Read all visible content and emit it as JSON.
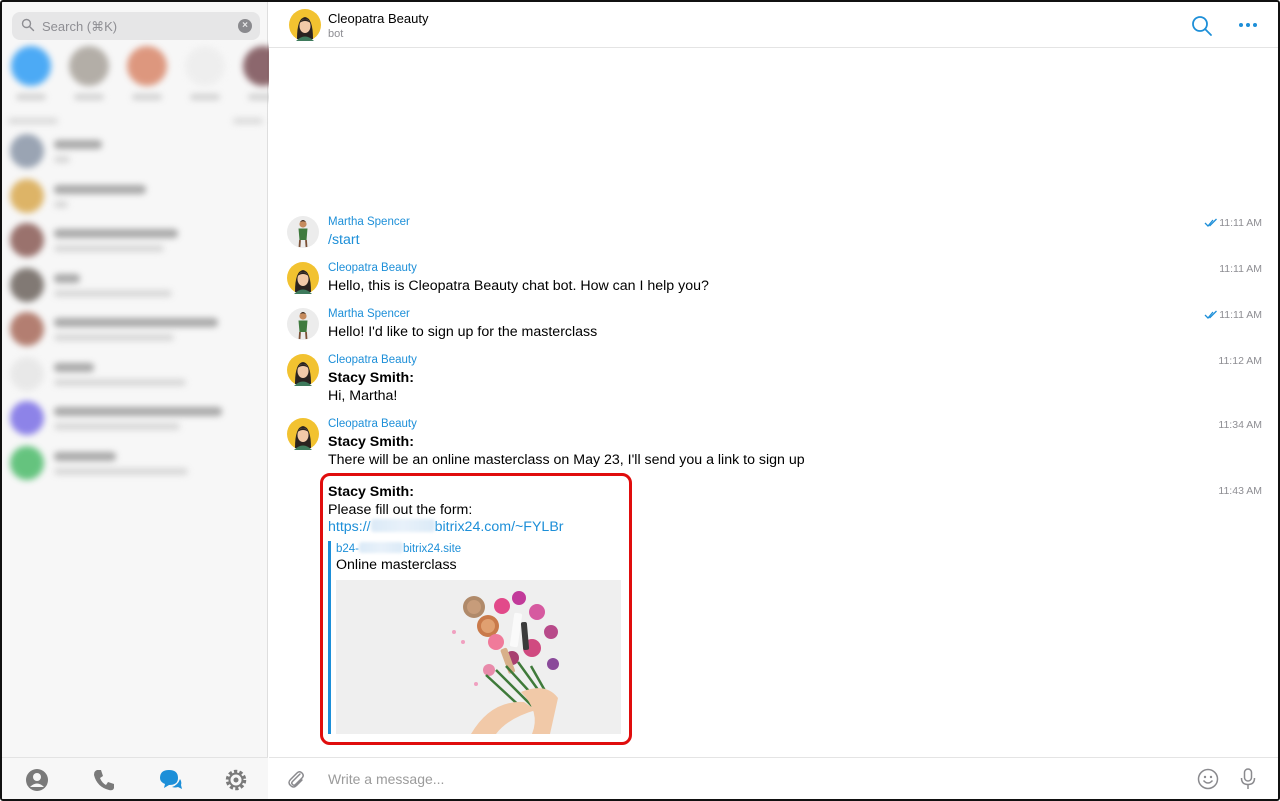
{
  "sidebar": {
    "search": {
      "placeholder": "Search (⌘K)"
    },
    "favorites": [
      "#2f9df5",
      "#a8a29a",
      "#d9876a",
      "#ededed",
      "#7a4f55"
    ],
    "chats": [
      {
        "avatar_color": "#8a96a8",
        "w1": 48,
        "w2": 16
      },
      {
        "avatar_color": "#d9a94f",
        "w1": 92,
        "w2": 14
      },
      {
        "avatar_color": "#8a5b55",
        "w1": 124,
        "w2": 110
      },
      {
        "avatar_color": "#6d645e",
        "w1": 26,
        "w2": 118
      },
      {
        "avatar_color": "#a86a5a",
        "w1": 164,
        "w2": 120
      },
      {
        "avatar_color": "#e6e6e6",
        "w1": 40,
        "w2": 132
      },
      {
        "avatar_color": "#7b6fe6",
        "w1": 168,
        "w2": 126
      },
      {
        "avatar_color": "#4cbb6a",
        "w1": 62,
        "w2": 134
      }
    ]
  },
  "header": {
    "title": "Cleopatra Beauty",
    "subtitle": "bot"
  },
  "messages": [
    {
      "author": "Martha Spencer",
      "time": "11:11 AM",
      "read": true,
      "avatar": "martha",
      "lines": [
        {
          "text": "/start",
          "style": "cmd"
        }
      ]
    },
    {
      "author": "Cleopatra Beauty",
      "time": "11:11 AM",
      "read": false,
      "avatar": "cleo",
      "lines": [
        {
          "text": "Hello, this is Cleopatra Beauty chat bot. How can I help you?",
          "style": ""
        }
      ]
    },
    {
      "author": "Martha Spencer",
      "time": "11:11 AM",
      "read": true,
      "avatar": "martha",
      "lines": [
        {
          "text": "Hello! I'd like to sign up for the masterclass",
          "style": ""
        }
      ]
    },
    {
      "author": "Cleopatra Beauty",
      "time": "11:12 AM",
      "read": false,
      "avatar": "cleo",
      "lines": [
        {
          "text": "Stacy Smith:",
          "style": "bold"
        },
        {
          "text": "Hi, Martha!",
          "style": ""
        }
      ]
    },
    {
      "author": "Cleopatra Beauty",
      "time": "11:34 AM",
      "read": false,
      "avatar": "cleo",
      "lines": [
        {
          "text": "Stacy Smith:",
          "style": "bold"
        },
        {
          "text": " There will be an online masterclass on May 23, I'll send you a link to sign up",
          "style": ""
        }
      ]
    }
  ],
  "form_message": {
    "time": "11:43 AM",
    "sender": "Stacy Smith:",
    "text": "Please fill out the form:",
    "link_prefix": "https://",
    "link_suffix": "bitrix24.com/~FYLBr",
    "preview": {
      "site_prefix": "b24-",
      "site_suffix": "bitrix24.site",
      "title": "Online masterclass"
    }
  },
  "composer": {
    "placeholder": "Write a message..."
  },
  "colors": {
    "accent": "#1d8fd8",
    "highlight": "#e00d0d"
  }
}
